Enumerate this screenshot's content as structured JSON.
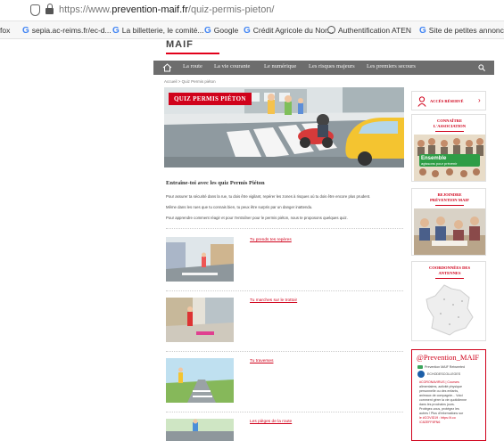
{
  "browser": {
    "url_prefix": "https://www.",
    "url_domain": "prevention-maif.fr",
    "url_path": "/quiz-permis-pieton/",
    "bookmarks": [
      "fox",
      "sepia.ac-reims.fr/ec-d...",
      "La billetterie, le comité...",
      "Google",
      "Crédit Agricole du Nor...",
      "Authentification ATEN",
      "Site de petites annonc..."
    ]
  },
  "site": {
    "brand": "MAIF",
    "nav": [
      "La route",
      "La vie courante",
      "Le numérique",
      "Les risques majeurs",
      "Les premiers secours"
    ],
    "breadcrumb": "Accueil  >  Quiz Permis piéton"
  },
  "hero": {
    "title": "QUIZ PERMIS PIÉTON"
  },
  "intro": {
    "heading": "Entraîne-toi avec les quiz Permis Piéton",
    "lines": [
      "Pour assurer ta sécurité dans la rue, tu dois être vigilant, repérer les zones à risques où tu dois être encore plus prudent.",
      "Même dans les rues que tu connais bien, tu peux être surpris par un danger inattendu.",
      "Pour apprendre comment réagir et pour t'entraîner pour le permis piéton, nous te proposons quelques quiz."
    ]
  },
  "quizzes": [
    {
      "label": "Tu prends tes repères"
    },
    {
      "label": "Tu marches sur le trottoir"
    },
    {
      "label": "Tu traverses"
    },
    {
      "label": "Les pièges de la route"
    }
  ],
  "sidebar": {
    "acces": "ACCÈS RÉSERVÉ",
    "connaitre": [
      "CONNAÎTRE",
      "L'ASSOCIATION"
    ],
    "ensemble_1": "Ensemble",
    "ensemble_2": "agissons pour prévenir",
    "rejoindre": [
      "REJOINDRE",
      "PRÉVENTION MAIF"
    ],
    "antennes": [
      "COORDONNÉES DES",
      "ANTENNES"
    ],
    "social_handle": "@Prevention_MAIF",
    "tweet": [
      "Prevention MAIF Retweeted",
      "ECHODESCOLLEGES",
      "#CORONAVIRUS | Courses",
      "alimentaires, activité physique",
      "personnelle ou des enfants,",
      "animaux de compagnie... Voici",
      "comment gérer la vie quotidienne",
      "dans les prochains jours.",
      "Protégez-vous, protégez les",
      "autres ! Plus d'informations sur",
      "le #COVID19 : https://t.co",
      "/C8ZEFF8FN6"
    ]
  },
  "colors": {
    "accent": "#d0021b",
    "nav_bg": "#6d6d6d"
  }
}
